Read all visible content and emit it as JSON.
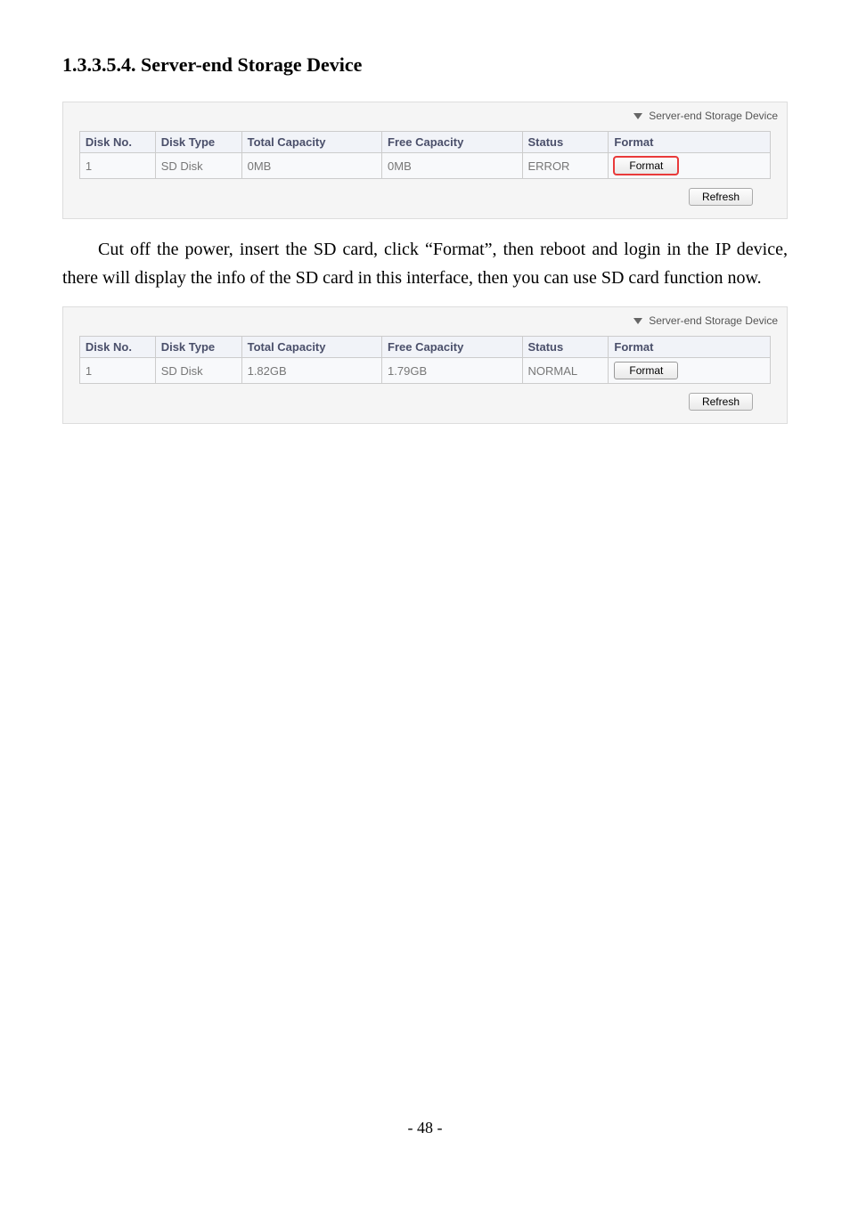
{
  "heading": "1.3.3.5.4. Server-end Storage Device",
  "panel_label": "Server-end Storage Device",
  "columns": {
    "diskno": "Disk No.",
    "disktype": "Disk Type",
    "totcap": "Total Capacity",
    "freecap": "Free Capacity",
    "status": "Status",
    "format": "Format"
  },
  "table1": {
    "diskno": "1",
    "disktype": "SD Disk",
    "totcap": "0MB",
    "freecap": "0MB",
    "status": "ERROR",
    "format_btn": "Format"
  },
  "table2": {
    "diskno": "1",
    "disktype": "SD Disk",
    "totcap": "1.82GB",
    "freecap": "1.79GB",
    "status": "NORMAL",
    "format_btn": "Format"
  },
  "refresh_btn": "Refresh",
  "paragraph": "Cut off the power, insert the SD card, click “Format”, then reboot and login in the IP device, there will display the info of the SD card in this interface, then you can use SD card function now.",
  "page_number": "- 48 -"
}
